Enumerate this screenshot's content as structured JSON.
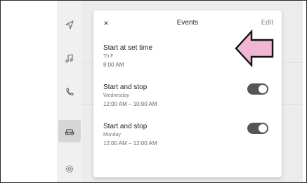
{
  "sidebar": {
    "items": [
      {
        "icon": "navigation-icon"
      },
      {
        "icon": "music-icon"
      },
      {
        "icon": "phone-icon"
      },
      {
        "icon": "car-icon",
        "active": true
      },
      {
        "icon": "settings-gear-icon"
      }
    ]
  },
  "modal": {
    "close_label": "×",
    "title": "Events",
    "edit_label": "Edit",
    "events": [
      {
        "title": "Start at set time",
        "days": "Th F",
        "time": "8:00 AM",
        "enabled": true
      },
      {
        "title": "Start and stop",
        "days": "Wednesday",
        "time": "12:00 AM – 10:00 AM",
        "enabled": true
      },
      {
        "title": "Start and stop",
        "days": "Monday",
        "time": "12:00 AM – 12:00 AM",
        "enabled": true
      }
    ]
  },
  "colors": {
    "toggle_on": "#555555",
    "arrow_fill": "#f1b6d3",
    "arrow_stroke": "#111111"
  },
  "annotation": {
    "icon": "callout-arrow-icon"
  }
}
